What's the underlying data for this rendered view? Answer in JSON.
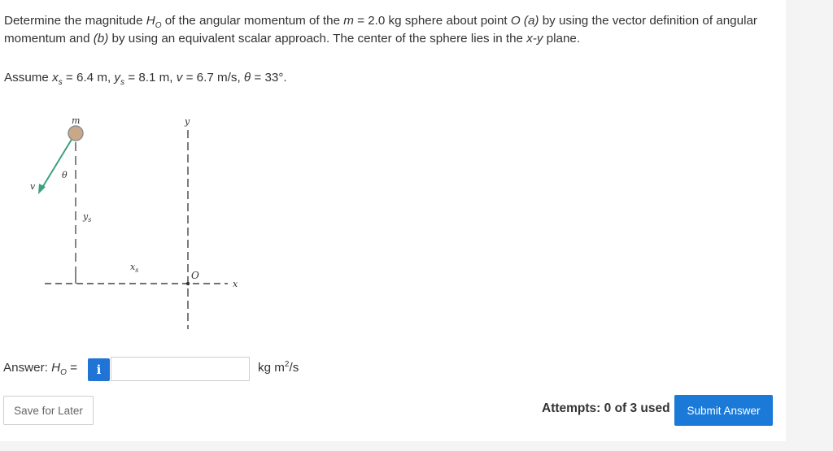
{
  "problem": {
    "p1": "Determine the magnitude ",
    "H": "H",
    "O": "O",
    "p2": " of the angular momentum of the ",
    "m": "m",
    "p3": " = 2.0 kg sphere about point ",
    "O2": "O",
    "p4": " ",
    "a": "(a)",
    "p5": " by using the vector definition of angular momentum and ",
    "b": "(b)",
    "p6": " by using an equivalent scalar approach. The center of the sphere lies in the ",
    "xy": "x-y",
    "p7": " plane."
  },
  "assume": {
    "prefix": "Assume ",
    "x": "x",
    "s1": "s",
    "xval": " = 6.4 m, ",
    "y": "y",
    "s2": "s",
    "yval": " = 8.1 m, ",
    "v": "v",
    "vval": " = 6.7 m/s, ",
    "theta": "θ",
    "tval": " = 33°."
  },
  "figure": {
    "m": "m",
    "y": "y",
    "theta": "θ",
    "v": "v",
    "ys": "ys",
    "xs": "xs",
    "O": "O",
    "x": "x"
  },
  "answer": {
    "label": "Answer: ",
    "H": "H",
    "O": "O",
    "eq": " = ",
    "info": "i",
    "value": "",
    "units": "kg m",
    "units_sup": "2",
    "units_tail": "/s"
  },
  "buttons": {
    "save": "Save for Later",
    "submit": "Submit Answer"
  },
  "attempts": "Attempts: 0 of 3 used",
  "colors": {
    "accent": "#1b7ad8",
    "velocity_arrow": "#3aa17b",
    "sphere": "#c9a889"
  }
}
